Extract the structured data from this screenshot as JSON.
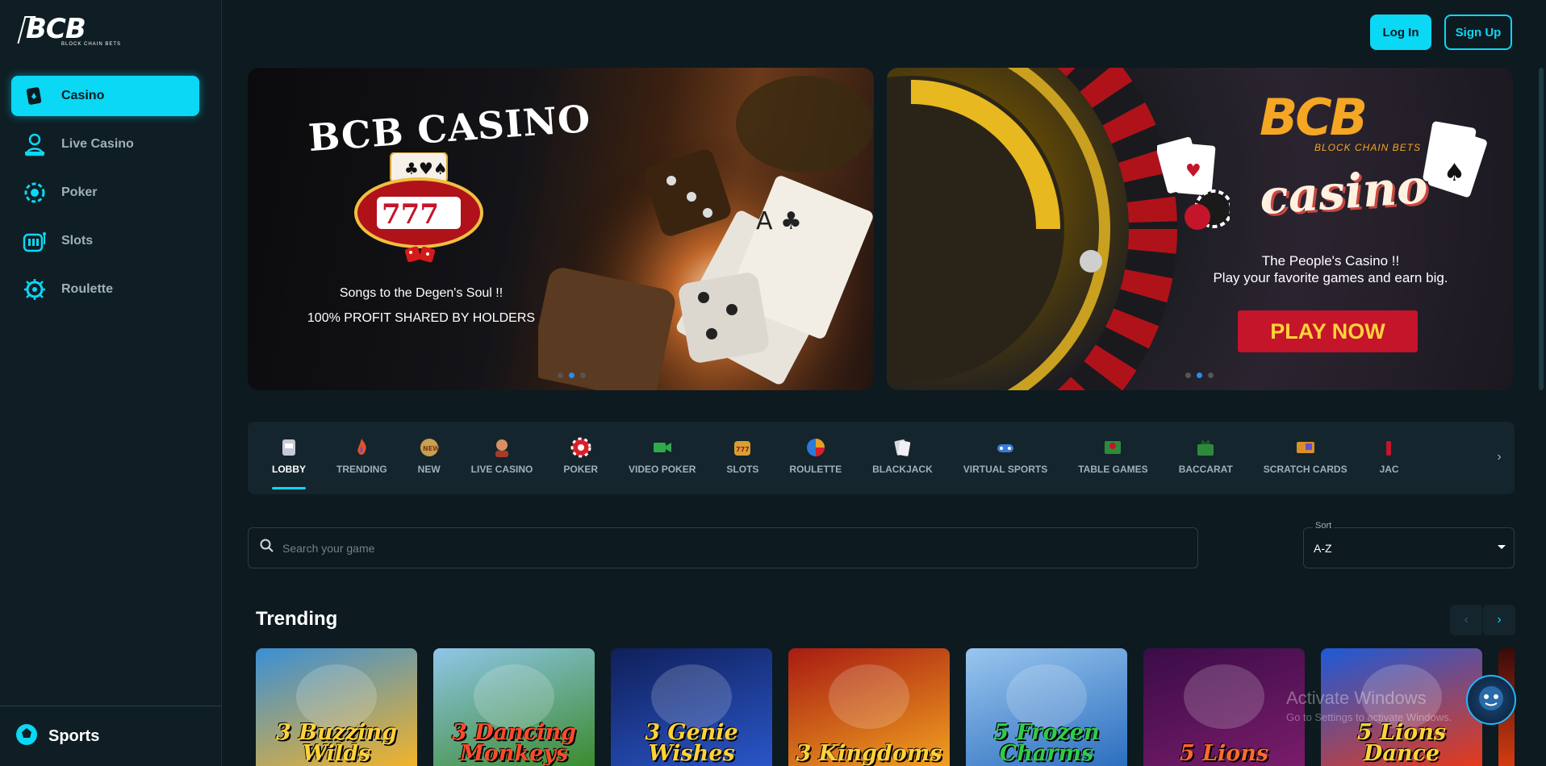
{
  "brand": {
    "logo_text": "BCB",
    "logo_sub": "BLOCK CHAIN BETS"
  },
  "sidebar": {
    "items": [
      {
        "label": "Casino",
        "icon": "card-icon",
        "active": true
      },
      {
        "label": "Live Casino",
        "icon": "dealer-icon",
        "active": false
      },
      {
        "label": "Poker",
        "icon": "poker-chip-icon",
        "active": false
      },
      {
        "label": "Slots",
        "icon": "slot-machine-icon",
        "active": false
      },
      {
        "label": "Roulette",
        "icon": "roulette-icon",
        "active": false
      }
    ],
    "bottom_label": "Sports"
  },
  "header": {
    "login_label": "Log In",
    "signup_label": "Sign Up"
  },
  "banners": [
    {
      "title": "BCB CASINO",
      "line1": "Songs to the Degen's Soul !!",
      "line2": "100% PROFIT SHARED BY HOLDERS"
    },
    {
      "logo_text": "BCB",
      "logo_sub": "BLOCK CHAIN BETS",
      "casino_word": "casino",
      "line1": "The People's Casino !!",
      "line2": "Play your favorite games and earn big.",
      "cta": "PLAY NOW"
    }
  ],
  "categories": [
    {
      "label": "LOBBY",
      "icon": "slot-machine-icon",
      "active": true
    },
    {
      "label": "TRENDING",
      "icon": "flame-icon",
      "active": false
    },
    {
      "label": "NEW",
      "icon": "new-badge-icon",
      "active": false
    },
    {
      "label": "LIVE CASINO",
      "icon": "dealer-icon",
      "active": false
    },
    {
      "label": "POKER",
      "icon": "poker-chip-icon",
      "active": false
    },
    {
      "label": "VIDEO POKER",
      "icon": "video-camera-icon",
      "active": false
    },
    {
      "label": "SLOTS",
      "icon": "slot-777-icon",
      "active": false
    },
    {
      "label": "ROULETTE",
      "icon": "roulette-wheel-icon",
      "active": false
    },
    {
      "label": "BLACKJACK",
      "icon": "cards-icon",
      "active": false
    },
    {
      "label": "VIRTUAL SPORTS",
      "icon": "gamepad-icon",
      "active": false
    },
    {
      "label": "TABLE GAMES",
      "icon": "table-icon",
      "active": false
    },
    {
      "label": "BACCARAT",
      "icon": "baccarat-icon",
      "active": false
    },
    {
      "label": "SCRATCH CARDS",
      "icon": "scratch-card-icon",
      "active": false
    },
    {
      "label": "JAC",
      "icon": "jackpot-icon",
      "active": false
    }
  ],
  "search": {
    "placeholder": "Search your game"
  },
  "sort": {
    "label": "Sort",
    "value": "A-Z"
  },
  "trending": {
    "title": "Trending",
    "games": [
      {
        "title": "3 Buzzing Wilds",
        "colors": [
          "#3a8fd6",
          "#f2b32a"
        ],
        "text_color": "#ffd23a"
      },
      {
        "title": "3 Dancing Monkeys",
        "colors": [
          "#8fc6e8",
          "#3c8b2e"
        ],
        "text_color": "#ff4a2a"
      },
      {
        "title": "3 Genie Wishes",
        "colors": [
          "#0f1f5a",
          "#2a56c8"
        ],
        "text_color": "#ffd23a"
      },
      {
        "title": "3 Kingdoms",
        "colors": [
          "#a81b12",
          "#f0a020"
        ],
        "text_color": "#ffd23a"
      },
      {
        "title": "5 Frozen Charms",
        "colors": [
          "#9ac6ee",
          "#2c6fc0"
        ],
        "text_color": "#2ecc4a"
      },
      {
        "title": "5 Lions",
        "colors": [
          "#3a0c48",
          "#7a1c6a"
        ],
        "text_color": "#ff6a2a"
      },
      {
        "title": "5 Lions Dance",
        "colors": [
          "#1c5ad8",
          "#e63a1a"
        ],
        "text_color": "#ffd23a"
      }
    ]
  },
  "watermark": {
    "line1": "Activate Windows",
    "line2": "Go to Settings to activate Windows."
  }
}
